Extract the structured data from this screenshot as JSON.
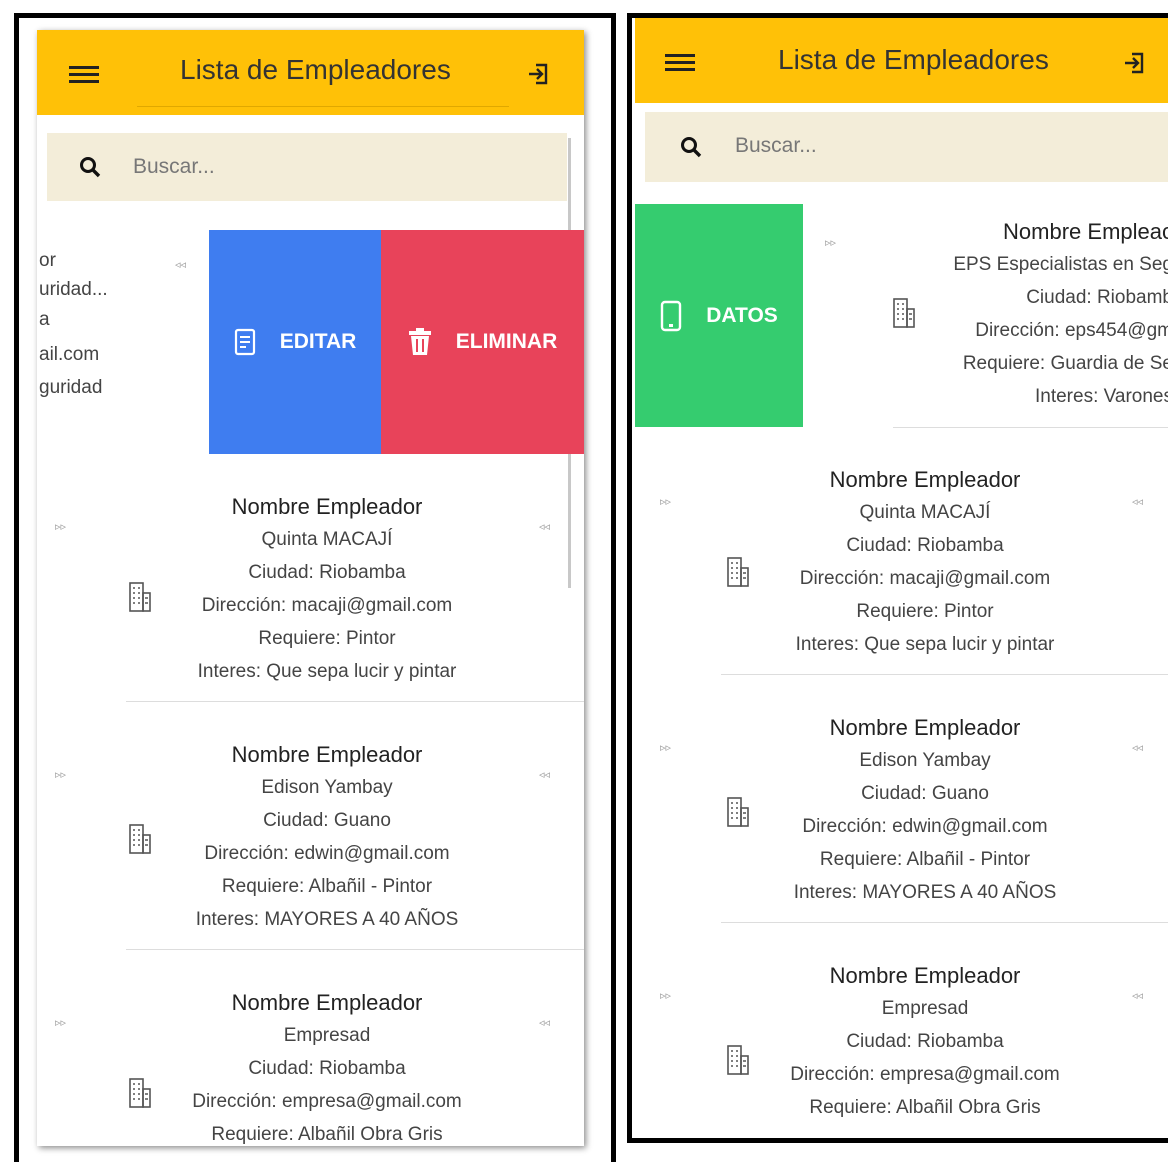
{
  "app": {
    "title": "Lista de Empleadores",
    "search_placeholder": "Buscar..."
  },
  "colors": {
    "header": "#ffc107",
    "search_bg": "#f3edd9",
    "edit": "#3f7df0",
    "delete": "#e8435a",
    "datos": "#35cc6f"
  },
  "icons": {
    "menu": "menu-icon",
    "logout": "logout-icon",
    "search": "search-icon",
    "building": "building-icon",
    "edit": "document-edit-icon",
    "delete": "trash-icon",
    "phone": "phone-icon"
  },
  "left": {
    "swiped_fragment": [
      "or",
      "uridad...",
      "a",
      "ail.com",
      "guridad"
    ],
    "actions": {
      "edit": "EDITAR",
      "delete": "ELIMINAR"
    },
    "employers": [
      {
        "name": "Nombre Empleador",
        "company": "Quinta MACAJÍ",
        "city": "Ciudad: Riobamba",
        "address": "Dirección: macaji@gmail.com",
        "requires": "Requiere: Pintor",
        "interest": "Interes: Que sepa lucir y pintar"
      },
      {
        "name": "Nombre Empleador",
        "company": "Edison Yambay",
        "city": "Ciudad: Guano",
        "address": "Dirección: edwin@gmail.com",
        "requires": "Requiere: Albañil - Pintor",
        "interest": "Interes: MAYORES A 40 AÑOS"
      },
      {
        "name": "Nombre Empleador",
        "company": "Empresad",
        "city": "Ciudad: Riobamba",
        "address": "Dirección: empresa@gmail.com",
        "requires": "Requiere: Albañil Obra Gris",
        "interest": ""
      }
    ]
  },
  "right": {
    "datos_label": "DATOS",
    "swiped": {
      "name": "Nombre Empleac",
      "company": "EPS Especialistas en Seg",
      "city": "Ciudad: Riobamb",
      "address": "Dirección: eps454@gm",
      "requires": "Requiere: Guardia de Se",
      "interest": "Interes: Varones"
    },
    "employers": [
      {
        "name": "Nombre Empleador",
        "company": "Quinta MACAJÍ",
        "city": "Ciudad: Riobamba",
        "address": "Dirección: macaji@gmail.com",
        "requires": "Requiere: Pintor",
        "interest": "Interes: Que sepa lucir y pintar"
      },
      {
        "name": "Nombre Empleador",
        "company": "Edison Yambay",
        "city": "Ciudad: Guano",
        "address": "Dirección: edwin@gmail.com",
        "requires": "Requiere: Albañil - Pintor",
        "interest": "Interes: MAYORES A 40 AÑOS"
      },
      {
        "name": "Nombre Empleador",
        "company": "Empresad",
        "city": "Ciudad: Riobamba",
        "address": "Dirección: empresa@gmail.com",
        "requires": "Requiere: Albañil Obra Gris",
        "interest": ""
      }
    ]
  }
}
